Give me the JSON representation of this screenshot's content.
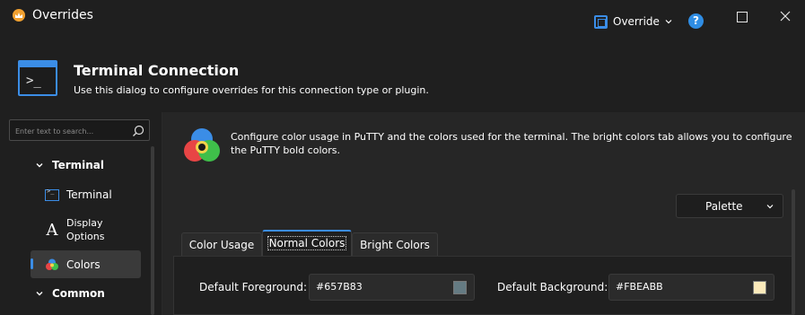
{
  "window": {
    "title": "Overrides"
  },
  "toolbar": {
    "override_label": "Override"
  },
  "header": {
    "title": "Terminal Connection",
    "subtitle": "Use this dialog to configure overrides for this connection type or plugin."
  },
  "sidebar": {
    "search_placeholder": "Enter text to search...",
    "groups": [
      {
        "label": "Terminal"
      },
      {
        "label": "Common"
      }
    ],
    "items": [
      {
        "label": "Terminal",
        "icon": "terminal-icon"
      },
      {
        "label": "Display\nOptions",
        "icon": "font-icon"
      },
      {
        "label": "Colors",
        "icon": "colors-icon"
      }
    ]
  },
  "main": {
    "intro": "Configure color usage in PuTTY and the colors used for the terminal. The bright colors tab allows you to configure the PuTTY bold colors.",
    "palette_label": "Palette",
    "tabs": [
      {
        "label": "Color Usage"
      },
      {
        "label": "Normal Colors"
      },
      {
        "label": "Bright Colors"
      }
    ],
    "fields": [
      {
        "label": "Default Foreground:",
        "value": "#657B83",
        "swatch": "#657B83"
      },
      {
        "label": "Default Background:",
        "value": "#FBEABB",
        "swatch": "#FBEABB"
      }
    ]
  },
  "colors": {
    "accent": "#3b8de6",
    "background": "#1f1f1f",
    "panel": "#262626"
  }
}
